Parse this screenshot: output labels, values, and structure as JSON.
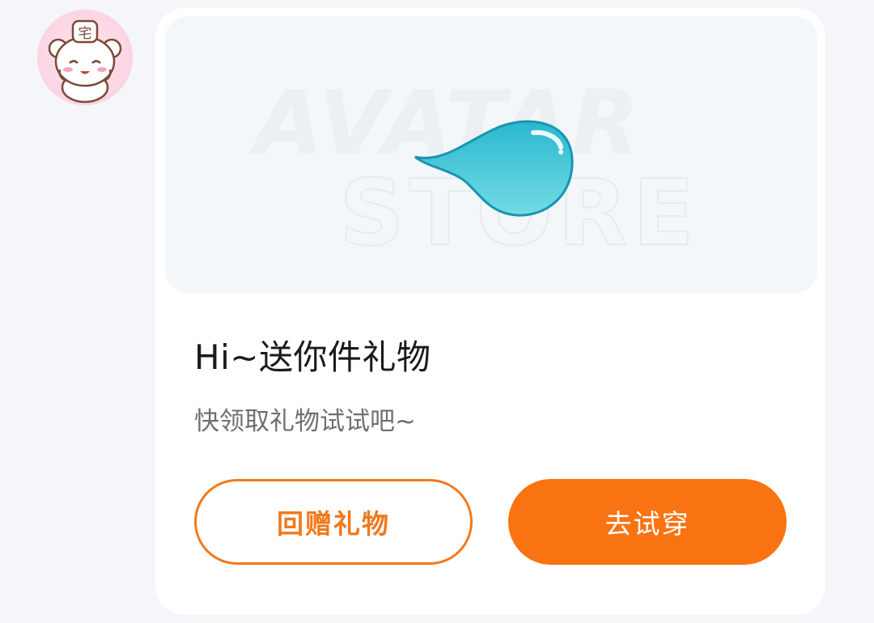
{
  "avatar": {
    "icon": "bear-avatar-icon",
    "badge_char": "宅"
  },
  "gift_card": {
    "watermark_line1": "AVATAR",
    "watermark_line2": "STORE",
    "item_icon": "water-drop-icon",
    "title": "Hi~送你件礼物",
    "subtitle": "快领取礼物试试吧~",
    "buttons": {
      "return_gift": "回赠礼物",
      "try_on": "去试穿"
    }
  },
  "colors": {
    "accent": "#fa7313",
    "outline": "#f07a1e",
    "drop": "#3fc6d8"
  }
}
